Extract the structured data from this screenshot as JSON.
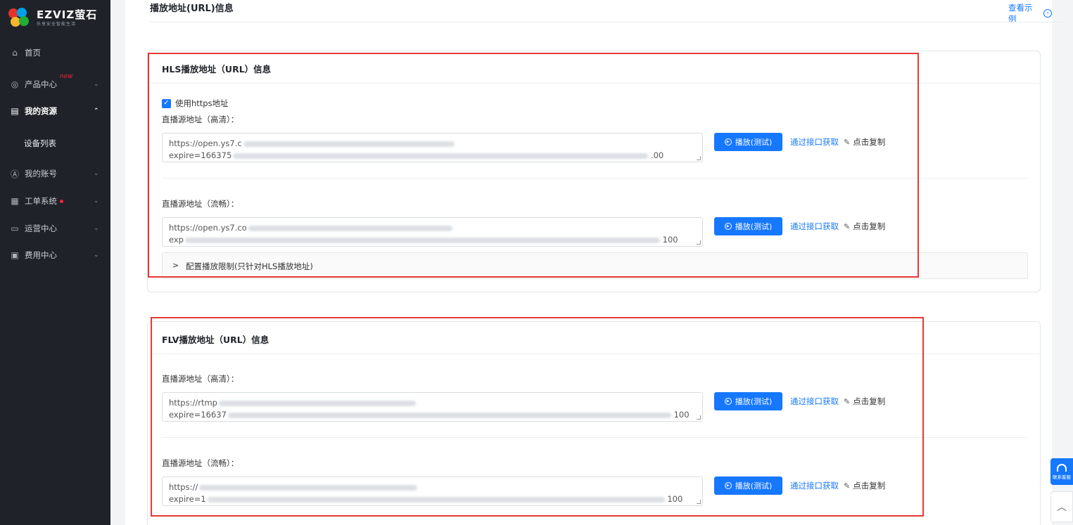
{
  "sidebar": {
    "brand": "EZVIZ萤石",
    "slogan": "乐享安全智能生活",
    "items": [
      {
        "label": "首页",
        "icon": "⌂"
      },
      {
        "label": "产品中心",
        "icon": "◎",
        "badge": "new"
      },
      {
        "label": "我的资源",
        "icon": "▤"
      },
      {
        "label": "设备列表"
      },
      {
        "label": "我的账号",
        "icon": "Ⓐ"
      },
      {
        "label": "工单系统",
        "icon": "▦"
      },
      {
        "label": "运营中心",
        "icon": "▭"
      },
      {
        "label": "费用中心",
        "icon": "▣"
      }
    ]
  },
  "page": {
    "title": "播放地址(URL)信息",
    "example_link": "查看示例"
  },
  "hls": {
    "title": "HLS播放地址（URL）信息",
    "https_label": "使用https地址",
    "hd_label": "直播源地址（高清）：",
    "hd_url_line1": "https://open.ys7.c",
    "hd_url_line2": "expire=166375",
    "hd_tail2": ".00",
    "smooth_label": "直播源地址（流畅）：",
    "smooth_url_line1": "https://open.ys7.co",
    "smooth_url_line2": "exp",
    "smooth_tail2": "100",
    "collapse_label": "配置播放限制(只针对HLS播放地址)"
  },
  "flv": {
    "title": "FLV播放地址（URL）信息",
    "hd_label": "直播源地址（高清）：",
    "hd_url_line1": "https://rtmp",
    "hd_url_line2": "expire=16637",
    "hd_tail2": "100",
    "smooth_label": "直播源地址（流畅）：",
    "smooth_url_line1": "https://",
    "smooth_url_line2": "expire=1",
    "smooth_tail2": "100"
  },
  "actions": {
    "play_label": "播放(测试)",
    "api_label": "通过接口获取",
    "copy_label": "点击复制"
  },
  "widgets": {
    "help_label": "联系客服"
  },
  "colors": {
    "accent": "#1677ff",
    "sidebar_bg": "#1f2329",
    "highlight_outline": "#e53935"
  }
}
